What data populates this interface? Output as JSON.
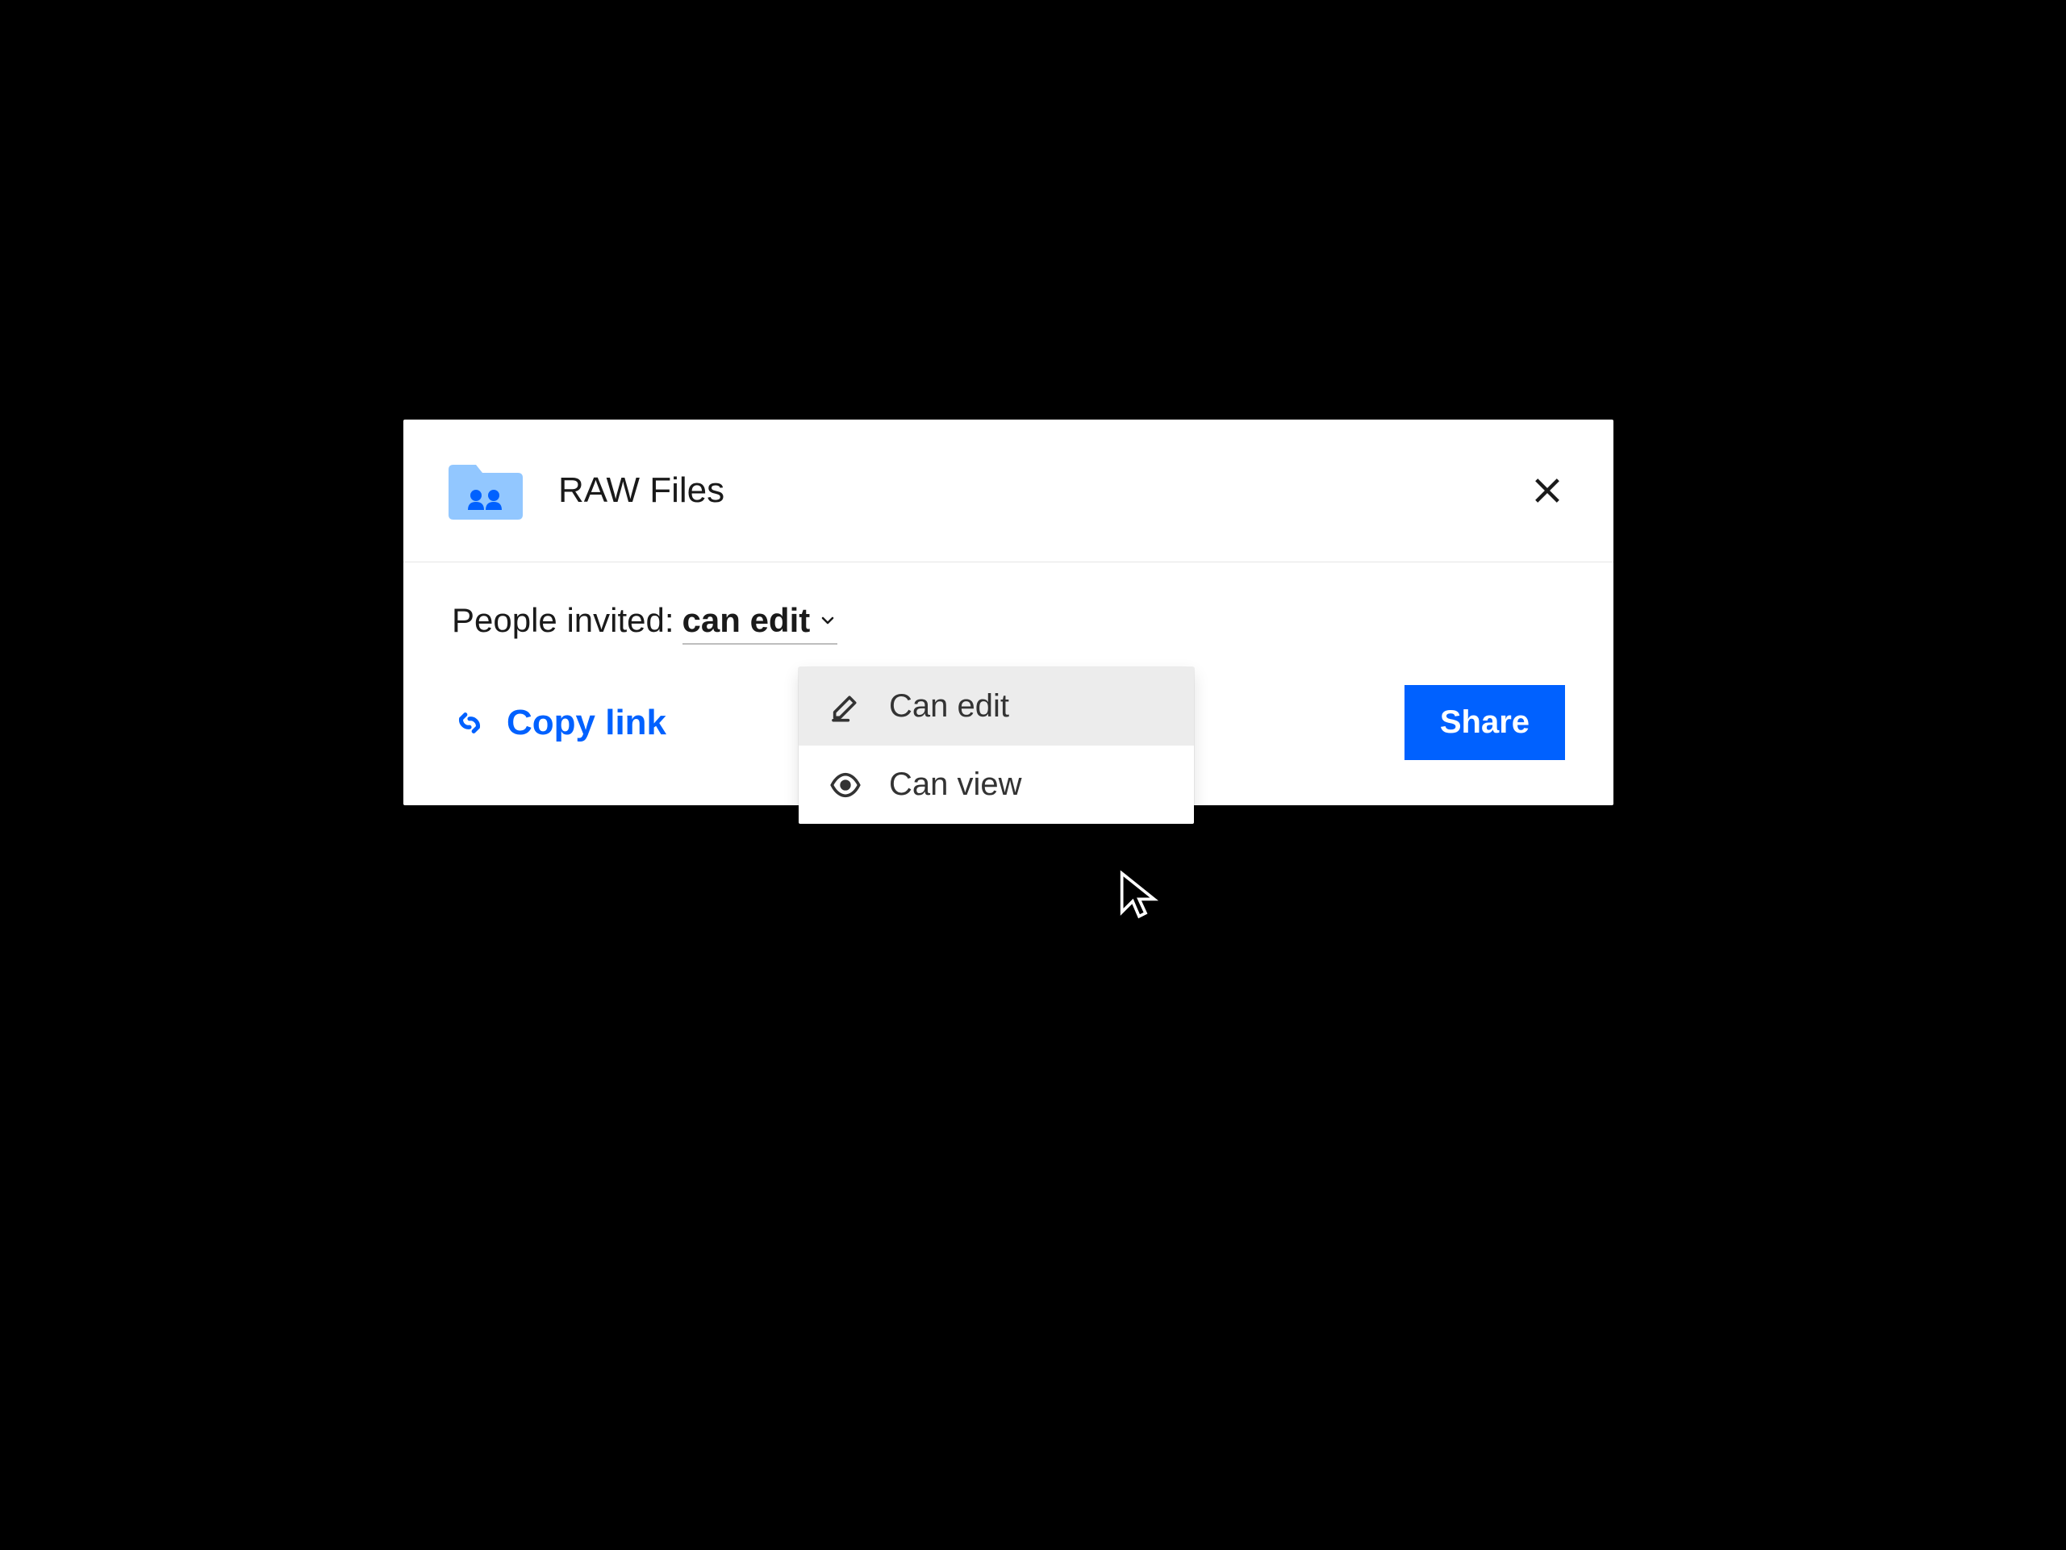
{
  "dialog": {
    "title": "RAW Files",
    "invite_label": "People invited:",
    "selected_permission": "can edit",
    "dropdown": {
      "items": [
        {
          "label": "Can edit"
        },
        {
          "label": "Can view"
        }
      ]
    },
    "copy_link_label": "Copy link",
    "share_label": "Share"
  },
  "colors": {
    "accent": "#0061ff",
    "folder": "#92c7ff"
  }
}
